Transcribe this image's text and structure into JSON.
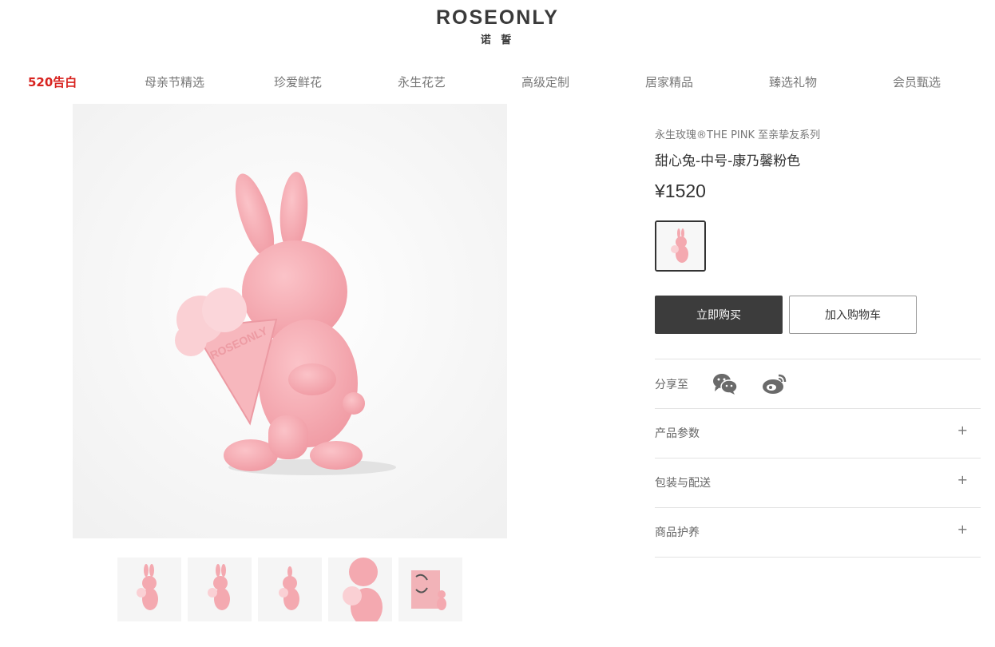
{
  "brand": {
    "name": "ROSEONLY",
    "subtitle": "诺 誓"
  },
  "nav": {
    "items": [
      {
        "label": "520告白",
        "active": true
      },
      {
        "label": "母亲节精选",
        "active": false
      },
      {
        "label": "珍爱鲜花",
        "active": false
      },
      {
        "label": "永生花艺",
        "active": false
      },
      {
        "label": "高级定制",
        "active": false
      },
      {
        "label": "居家精品",
        "active": false
      },
      {
        "label": "臻选礼物",
        "active": false
      },
      {
        "label": "会员甄选",
        "active": false
      }
    ]
  },
  "product": {
    "series": "永生玫瑰®THE PINK 至亲挚友系列",
    "title": "甜心兔-中号-康乃馨粉色",
    "price": "¥1520",
    "bouquet_text": "ROSEONLY"
  },
  "actions": {
    "buy_label": "立即购买",
    "cart_label": "加入购物车"
  },
  "share": {
    "label": "分享至",
    "icons": [
      "wechat-icon",
      "weibo-icon"
    ]
  },
  "accordion": [
    {
      "label": "产品参数",
      "icon": "+"
    },
    {
      "label": "包装与配送",
      "icon": "+"
    },
    {
      "label": "商品护养",
      "icon": "+"
    }
  ],
  "colors": {
    "accent": "#d8231f",
    "button_dark": "#3c3c3c",
    "bunny_pink": "#f4a9b0"
  }
}
